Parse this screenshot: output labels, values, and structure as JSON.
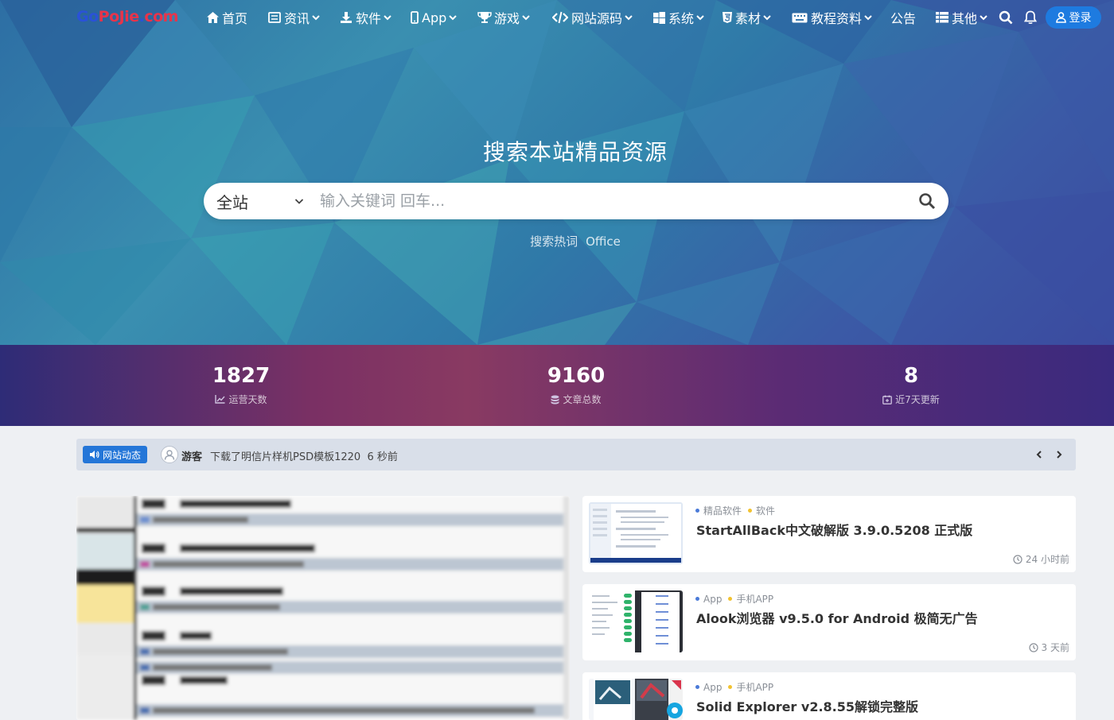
{
  "site": {
    "logo_go": "Go",
    "logo_pojie": "PoJie",
    "logo_dot": ".",
    "logo_com": "com"
  },
  "nav": {
    "items": [
      {
        "label": "首页",
        "icon": "home-icon",
        "dropdown": false
      },
      {
        "label": "资讯",
        "icon": "news-icon",
        "dropdown": true
      },
      {
        "label": "软件",
        "icon": "download-icon",
        "dropdown": true
      },
      {
        "label": "App",
        "icon": "mobile-icon",
        "dropdown": true
      },
      {
        "label": "游戏",
        "icon": "trophy-icon",
        "dropdown": true
      },
      {
        "label": "网站源码",
        "icon": "code-icon",
        "dropdown": true
      },
      {
        "label": "系统",
        "icon": "windows-icon",
        "dropdown": true
      },
      {
        "label": "素材",
        "icon": "html5-icon",
        "dropdown": true
      },
      {
        "label": "教程资料",
        "icon": "keyboard-icon",
        "dropdown": true
      },
      {
        "label": "公告",
        "icon": "",
        "dropdown": false
      },
      {
        "label": "其他",
        "icon": "table-icon",
        "dropdown": true
      }
    ],
    "login_label": "登录"
  },
  "hero": {
    "title": "搜索本站精品资源",
    "scope": "全站",
    "placeholder": "输入关键词 回车...",
    "hot_label": "搜索热词",
    "hot_keywords": [
      "Office"
    ]
  },
  "stats": [
    {
      "value": "1827",
      "label": "运营天数",
      "icon": "chart-line-icon"
    },
    {
      "value": "9160",
      "label": "文章总数",
      "icon": "database-icon"
    },
    {
      "value": "8",
      "label": "近7天更新",
      "icon": "calendar-icon"
    }
  ],
  "ticker": {
    "badge": "网站动态",
    "user": "游客",
    "message": "下载了明信片样机PSD模板1220",
    "time": "6 秒前"
  },
  "posts": [
    {
      "cat1": "精品软件",
      "cat2": "软件",
      "title": "StartAllBack中文破解版 3.9.0.5208 正式版",
      "time": "24 小时前"
    },
    {
      "cat1": "App",
      "cat2": "手机APP",
      "title": "Alook浏览器 v9.5.0 for Android 极简无广告",
      "time": "3 天前"
    },
    {
      "cat1": "App",
      "cat2": "手机APP",
      "title": "Solid Explorer v2.8.55解锁完整版",
      "time": ""
    }
  ],
  "colors": {
    "accent": "#1e7be0",
    "cat_dot_1": "#4a7ad8",
    "cat_dot_2": "#f2c230",
    "logo_red": "#e8344a",
    "logo_blue": "#2a52d8"
  }
}
